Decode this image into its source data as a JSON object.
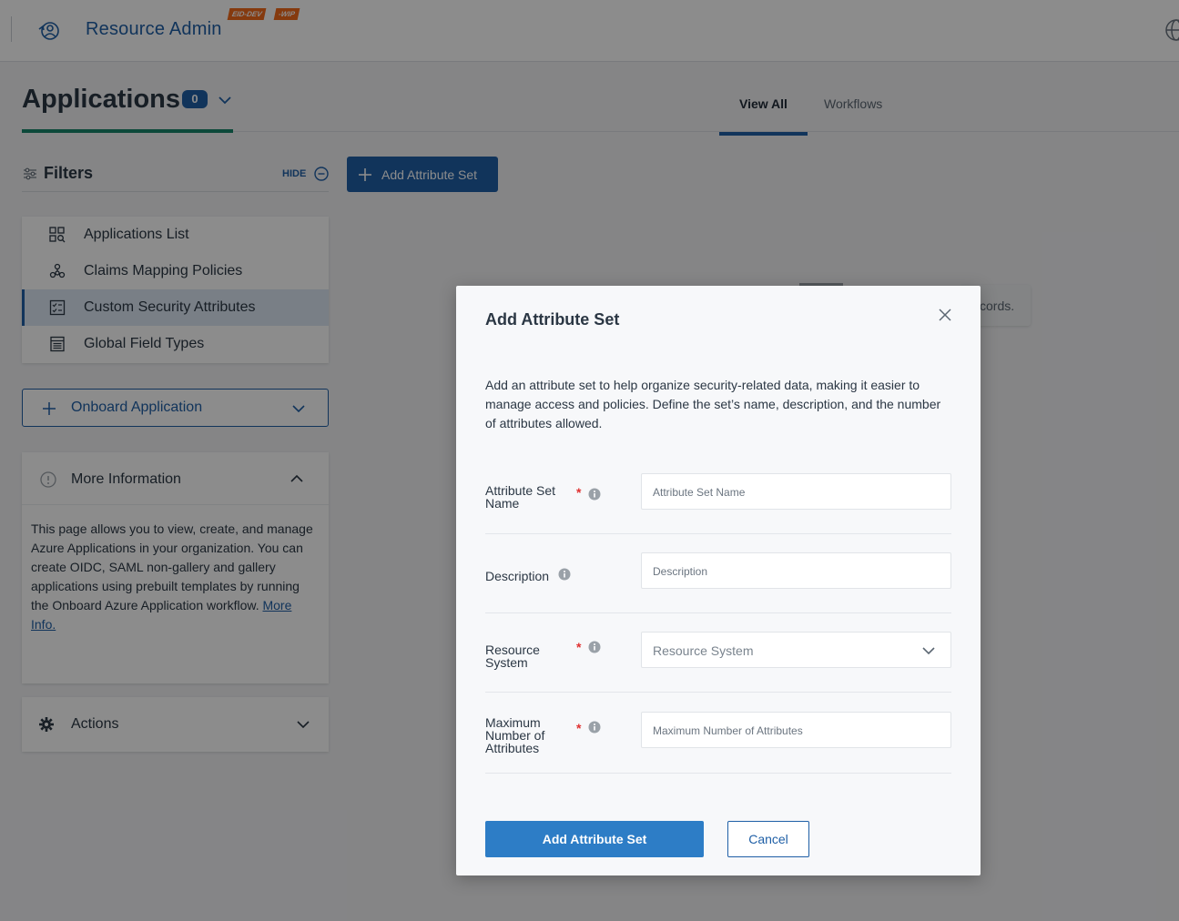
{
  "header": {
    "app_title": "Resource Admin",
    "env_badges": [
      "EID-DEV",
      "-WIP"
    ]
  },
  "page": {
    "title": "Applications",
    "count": "0",
    "tabs": [
      {
        "label": "View All",
        "active": true
      },
      {
        "label": "Workflows",
        "active": false
      }
    ]
  },
  "filters": {
    "label": "Filters",
    "hide_label": "HIDE"
  },
  "toolbar": {
    "add_attribute_set_label": "Add Attribute Set"
  },
  "nav": {
    "items": [
      {
        "label": "Applications List",
        "icon": "search-list-icon"
      },
      {
        "label": "Claims Mapping Policies",
        "icon": "nodes-icon"
      },
      {
        "label": "Custom Security Attributes",
        "icon": "checklist-icon",
        "active": true
      },
      {
        "label": "Global Field Types",
        "icon": "table-icon"
      }
    ]
  },
  "onboard": {
    "label": "Onboard Application"
  },
  "more_info": {
    "title": "More Information",
    "text": "This page allows you to view, create, and manage Azure Applications in your organization. You can create OIDC, SAML non-gallery and gallery applications using prebuilt templates by running the Onboard Azure Application workflow.",
    "link_text": "More Info."
  },
  "actions": {
    "label": "Actions"
  },
  "no_records": {
    "text": "cords."
  },
  "modal": {
    "title": "Add Attribute Set",
    "description": "Add an attribute set to help organize security-related data, making it easier to manage access and policies. Define the set’s name, description, and the number of attributes allowed.",
    "fields": [
      {
        "label": "Attribute Set Name",
        "placeholder": "Attribute Set Name",
        "required": true
      },
      {
        "label": "Description",
        "placeholder": "Description",
        "required": false
      },
      {
        "label": "Resource System",
        "placeholder": "Resource System",
        "required": true
      },
      {
        "label": "Maximum Number of Attributes",
        "placeholder": "Maximum Number of Attributes",
        "required": true
      }
    ],
    "required_mark": "*",
    "submit_label": "Add Attribute Set",
    "cancel_label": "Cancel"
  },
  "colors": {
    "brand_blue": "#1f5fa6",
    "accent_green": "#16866a",
    "env_orange": "#f26a1b",
    "required_red": "#e03131"
  }
}
